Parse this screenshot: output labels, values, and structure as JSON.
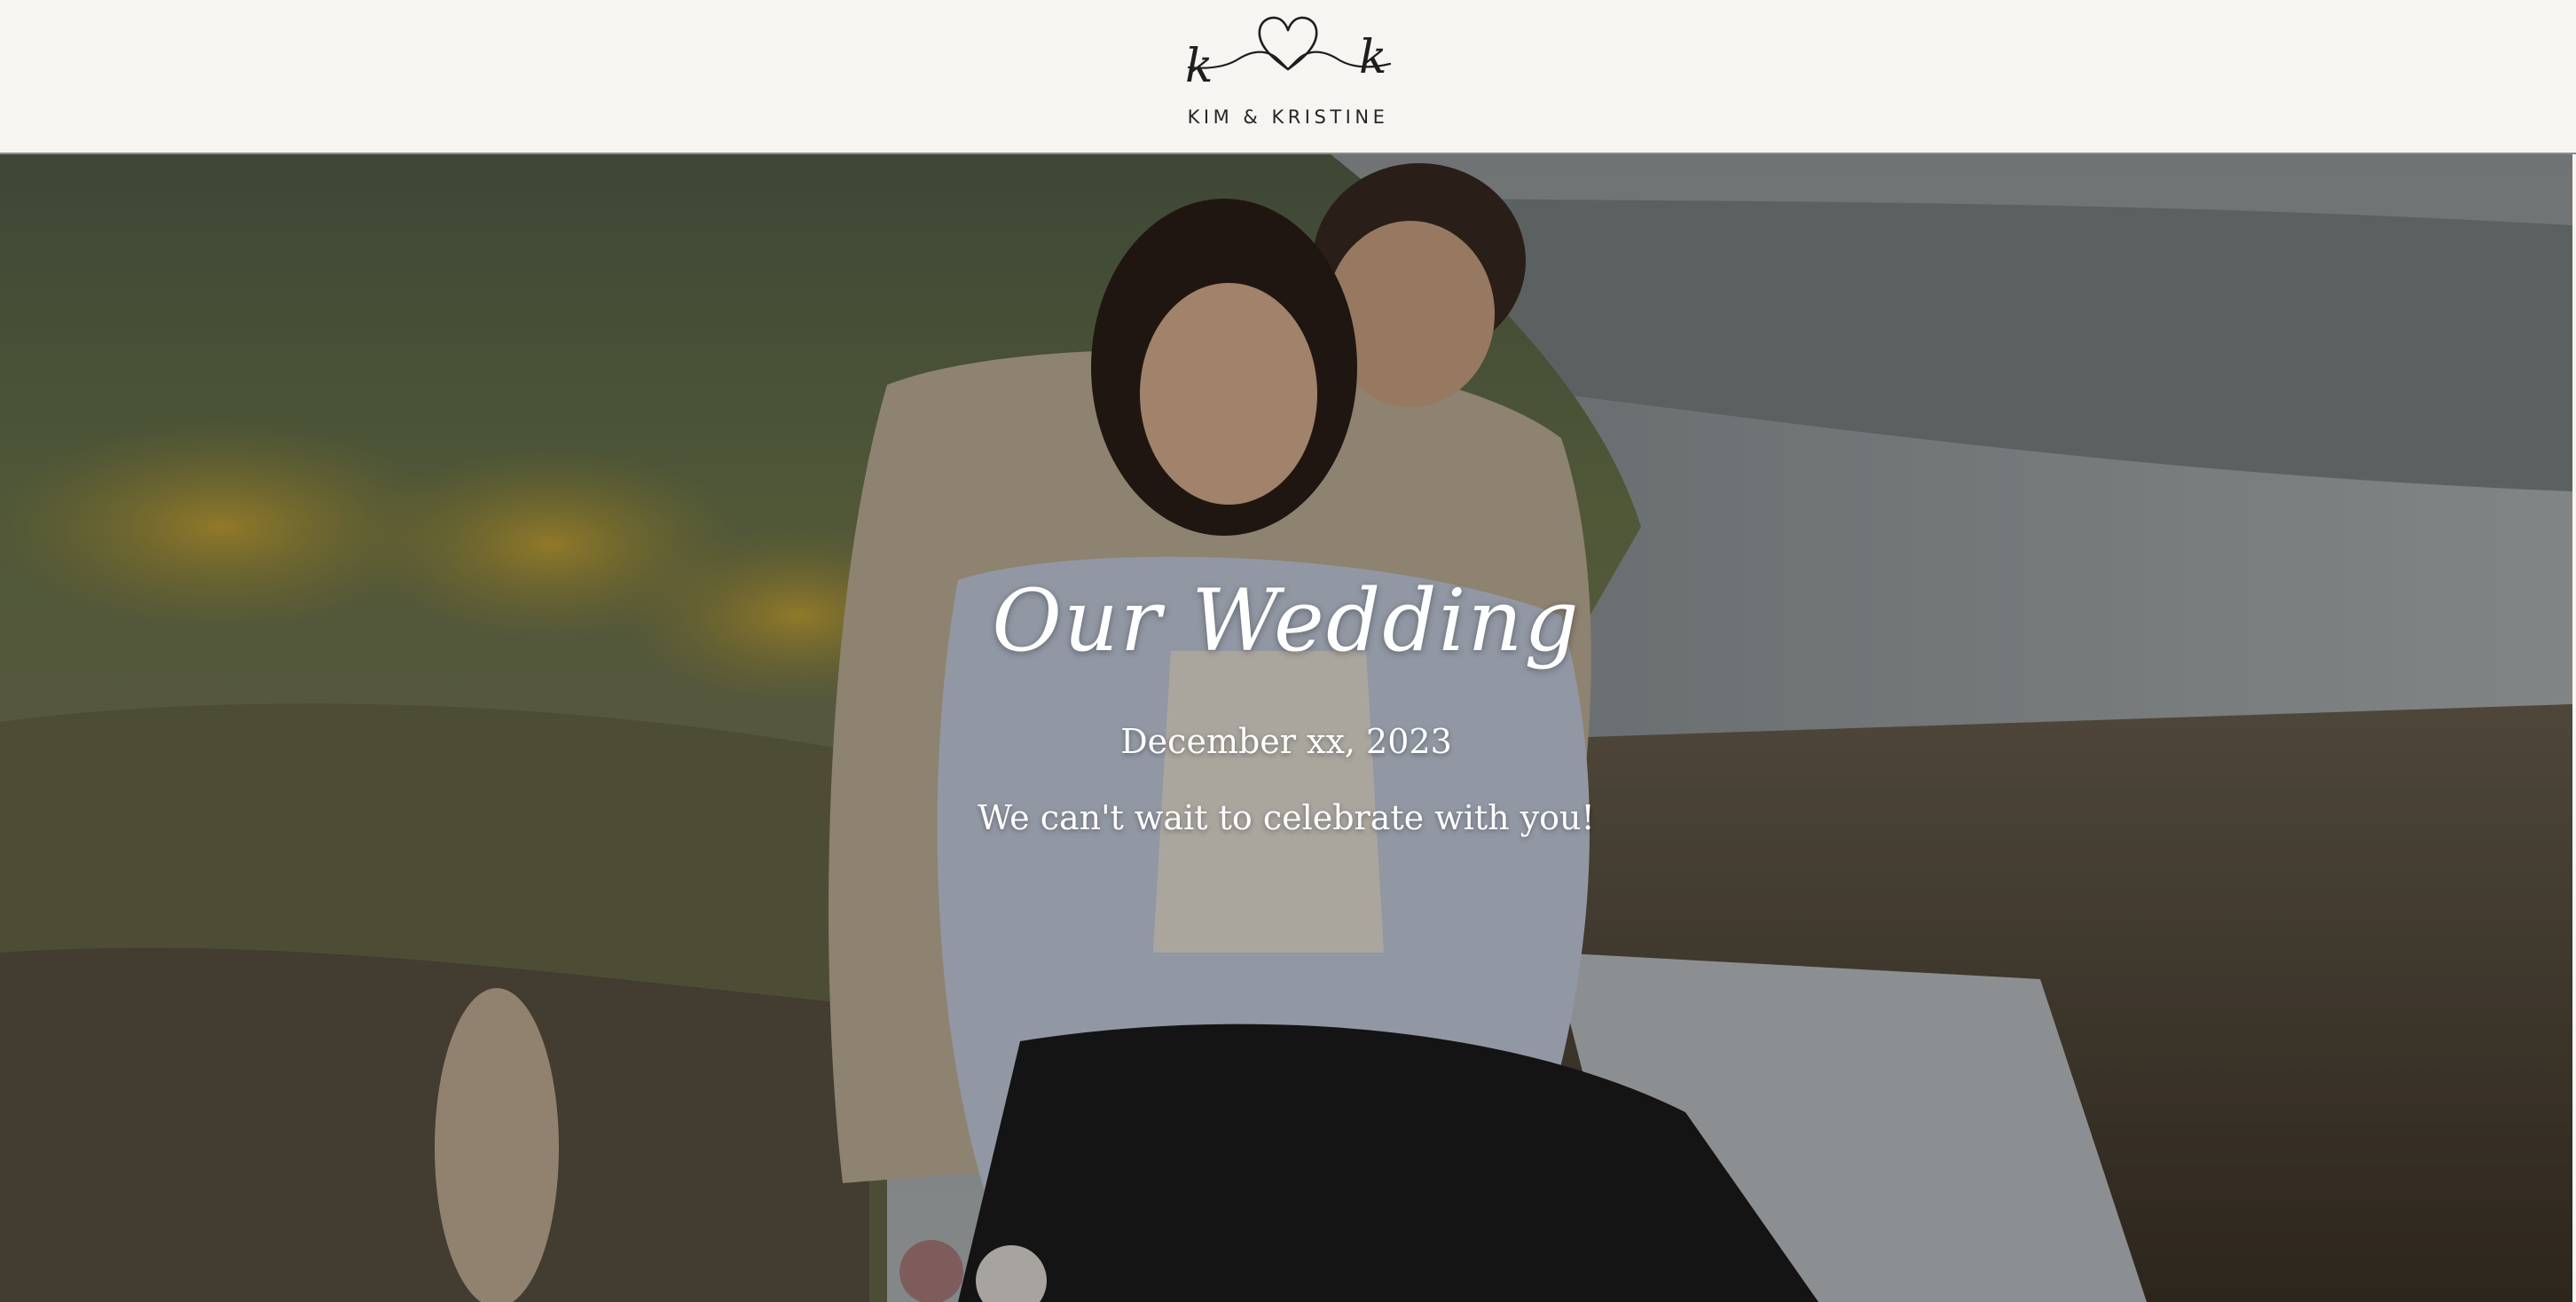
{
  "header": {
    "logo_text": "KIM & KRISTINE",
    "logo_initial_left": "k",
    "logo_initial_right": "k"
  },
  "hero": {
    "title": "Our Wedding",
    "date": "December xx, 2023",
    "subtitle": "We can't wait to celebrate with you!",
    "image_description": "couple-photo-overlooking-sea",
    "overlay_color": "#000000"
  },
  "colors": {
    "header_bg": "#f6f5f1",
    "text_dark": "#262626",
    "hero_text": "#ffffff"
  }
}
